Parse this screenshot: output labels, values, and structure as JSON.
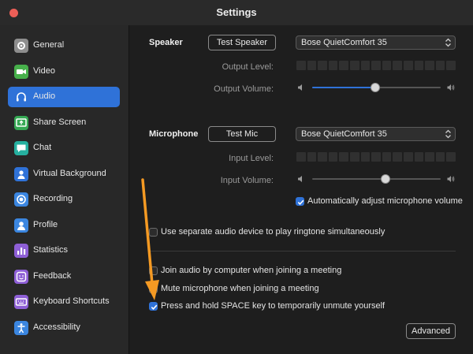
{
  "window": {
    "title": "Settings"
  },
  "sidebar": {
    "items": [
      {
        "label": "General",
        "icon": "gear-icon",
        "color": "#8e8e8e",
        "active": false
      },
      {
        "label": "Video",
        "icon": "video-camera-icon",
        "color": "#47b04b",
        "active": false
      },
      {
        "label": "Audio",
        "icon": "headphones-icon",
        "color": "#2f72d8",
        "active": true
      },
      {
        "label": "Share Screen",
        "icon": "share-screen-icon",
        "color": "#35a853",
        "active": false
      },
      {
        "label": "Chat",
        "icon": "chat-bubble-icon",
        "color": "#26b0a0",
        "active": false
      },
      {
        "label": "Virtual Background",
        "icon": "person-icon",
        "color": "#2f72d8",
        "active": false
      },
      {
        "label": "Recording",
        "icon": "record-icon",
        "color": "#3b86e0",
        "active": false
      },
      {
        "label": "Profile",
        "icon": "profile-icon",
        "color": "#3b86e0",
        "active": false
      },
      {
        "label": "Statistics",
        "icon": "bar-chart-icon",
        "color": "#8e5fd6",
        "active": false
      },
      {
        "label": "Feedback",
        "icon": "smiley-icon",
        "color": "#8e5fd6",
        "active": false
      },
      {
        "label": "Keyboard Shortcuts",
        "icon": "keyboard-icon",
        "color": "#8e5fd6",
        "active": false
      },
      {
        "label": "Accessibility",
        "icon": "accessibility-icon",
        "color": "#3b86e0",
        "active": false
      }
    ]
  },
  "speaker": {
    "section_label": "Speaker",
    "test_button": "Test Speaker",
    "device": "Bose QuietComfort 35",
    "level_label": "Output Level:",
    "volume_label": "Output Volume:",
    "volume_fraction": 0.49
  },
  "microphone": {
    "section_label": "Microphone",
    "test_button": "Test Mic",
    "device": "Bose QuietComfort 35",
    "level_label": "Input Level:",
    "volume_label": "Input Volume:",
    "volume_fraction": 0.57,
    "auto_adjust_label": "Automatically adjust microphone volume",
    "auto_adjust_checked": true
  },
  "options": {
    "separate_device_label": "Use separate audio device to play ringtone simultaneously",
    "separate_device_checked": false,
    "join_audio_label": "Join audio by computer when joining a meeting",
    "join_audio_checked": false,
    "mute_mic_label": "Mute microphone when joining a meeting",
    "mute_mic_checked": false,
    "push_to_talk_label": "Press and hold SPACE key to temporarily unmute yourself",
    "push_to_talk_checked": true
  },
  "advanced_button": "Advanced",
  "colors": {
    "accent": "#2f72d8",
    "annotation_arrow": "#f59a23"
  }
}
